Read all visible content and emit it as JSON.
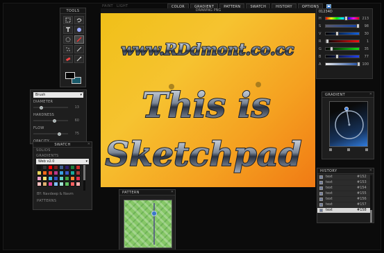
{
  "modes": [
    "PAINT",
    "LIGHT"
  ],
  "menu": [
    "COLOR",
    "GRADIENT",
    "PATTERN",
    "SWATCH",
    "HISTORY",
    "OPTIONS"
  ],
  "tools": {
    "title": "TOOLS",
    "items": [
      "select-rect-icon",
      "select-lasso-icon",
      "text-icon",
      "shape-icon",
      "stamp-icon",
      "brush-icon",
      "spray-icon",
      "line-icon",
      "eraser-icon",
      "eyedropper-icon"
    ]
  },
  "brush": {
    "select": "Brush",
    "props": [
      {
        "label": "DIAMETER",
        "value": "13",
        "level": 0.18
      },
      {
        "label": "HARDNESS",
        "value": "60",
        "level": 0.6
      },
      {
        "label": "FLOW",
        "value": "75",
        "level": 0.75
      },
      {
        "label": "OPACITY",
        "value": "",
        "level": 0.95
      }
    ]
  },
  "swatch": {
    "title": "SWATCH",
    "solids": "SOLIDS",
    "gradients": "GRADIENTS",
    "select": "Web v2.0",
    "credit": "BY: Navdeep & Navm",
    "patterns": "PATTERNS",
    "colors": [
      "#111111",
      "#333333",
      "#ff0000",
      "#7a1a1a",
      "#3a5a8a",
      "#2a1a6a",
      "#1a7a3a",
      "#cc2a2a",
      "#e4d25a",
      "#f06a1a",
      "#e83838",
      "#bb3a8a",
      "#3aa0e0",
      "#3a5ac8",
      "#1aaa9a",
      "#aa3a3a",
      "#e8a0c8",
      "#f0e070",
      "#40b8e0",
      "#3050c0",
      "#60d0c0",
      "#40a040",
      "#ff8030",
      "#e03050",
      "#ffc0c0",
      "#e0b070",
      "#e040a0",
      "#80c0ff",
      "#a0e0d0",
      "#60c060",
      "#ff6060",
      "#ffb0b0"
    ]
  },
  "canvas": {
    "title": "DRAWING PNG",
    "text_top": "www.RDdmont.co.cc",
    "text_mid": "This is",
    "text_bottom": "Sketchpad"
  },
  "color": {
    "hex": "01234D",
    "rows": [
      {
        "label": "H",
        "value": "213",
        "level": 0.59,
        "gradient": "linear-gradient(90deg,#f00,#ff0,#0f0,#0ff,#00f,#f0f,#f00)"
      },
      {
        "label": "S",
        "value": "98",
        "level": 0.98,
        "gradient": "linear-gradient(90deg,#5a5a6a,#1040a8)"
      },
      {
        "label": "V",
        "value": "30",
        "level": 0.3,
        "gradient": "linear-gradient(90deg,#000,#1060e0)"
      },
      {
        "label": "R",
        "value": "1",
        "level": 0.01,
        "gradient": "linear-gradient(90deg,#000,#f01010)"
      },
      {
        "label": "G",
        "value": "35",
        "level": 0.14,
        "gradient": "linear-gradient(90deg,#000,#10e010)"
      },
      {
        "label": "B",
        "value": "77",
        "level": 0.3,
        "gradient": "linear-gradient(90deg,#000,#2040f0)"
      },
      {
        "label": "A",
        "value": "100",
        "level": 1.0,
        "gradient": "linear-gradient(90deg,#eee,#1a4aa0)"
      }
    ]
  },
  "gradient": {
    "title": "GRADIENT",
    "direction_deg": 20
  },
  "history": {
    "title": "HISTORY",
    "items": [
      {
        "label": "text",
        "num": "#152"
      },
      {
        "label": "text",
        "num": "#153"
      },
      {
        "label": "text",
        "num": "#154"
      },
      {
        "label": "text",
        "num": "#155"
      },
      {
        "label": "text",
        "num": "#156"
      },
      {
        "label": "text",
        "num": "#157"
      },
      {
        "label": "text",
        "num": "#158"
      }
    ]
  },
  "pattern": {
    "title": "PATTERN",
    "level": 0.2
  }
}
